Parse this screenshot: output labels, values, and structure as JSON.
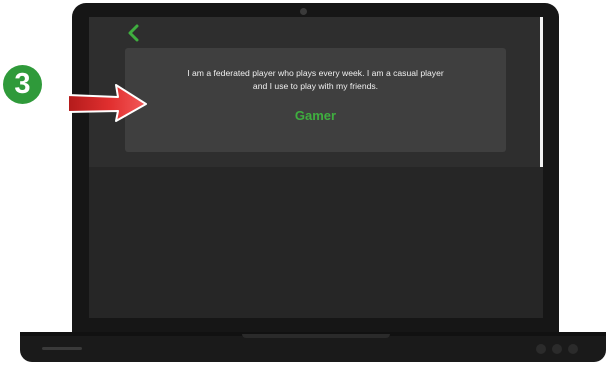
{
  "annotation": {
    "step_number": "3",
    "arrow_icon": "arrow-right-icon"
  },
  "screen": {
    "back_icon": "chevron-left-icon",
    "card": {
      "line_1": "I am a federated player who plays every week. I am a casual player",
      "line_2": "and I use to play with my friends.",
      "label": "Gamer"
    }
  },
  "colors": {
    "accent": "#3fae3f",
    "badge": "#2f9a3a",
    "arrow": "#e23030"
  }
}
